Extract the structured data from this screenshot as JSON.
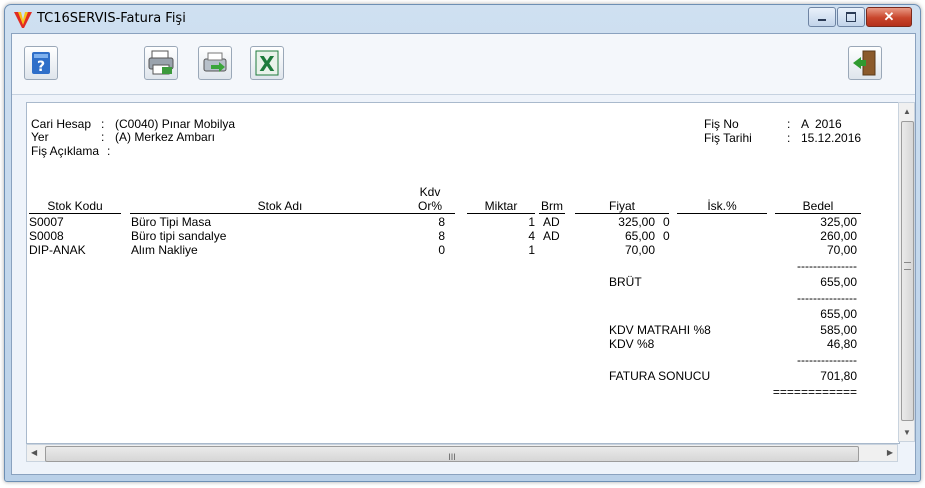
{
  "window": {
    "title": "TC16SERVIS-Fatura Fişi"
  },
  "toolbar": {
    "icons": [
      "help-icon",
      "print-preview-icon",
      "send-icon",
      "excel-icon",
      "exit-door-icon"
    ]
  },
  "header": {
    "cari_hesap_label": "Cari Hesap",
    "cari_hesap_value": "(C0040) Pınar Mobilya",
    "yer_label": "Yer",
    "yer_value": "(A) Merkez Ambarı",
    "fis_aciklama_label": "Fiş Açıklama",
    "fis_aciklama_value": "",
    "fis_no_label": "Fiş No",
    "fis_no_value": "A  2016",
    "fis_tarihi_label": "Fiş Tarihi",
    "fis_tarihi_value": "15.12.2016",
    "colon": ":"
  },
  "table": {
    "headers": {
      "stok_kodu": "Stok Kodu",
      "stok_adi": "Stok Adı",
      "kdv_line1": "Kdv",
      "kdv_line2": "Or%",
      "miktar": "Miktar",
      "brm": "Brm",
      "fiyat": "Fiyat",
      "isk": "İsk.%",
      "bedel": "Bedel"
    },
    "rows": [
      {
        "stok_kodu": "S0007",
        "stok_adi": "Büro Tipi Masa",
        "kdv": "8",
        "miktar": "1",
        "brm": "AD",
        "fiyat": "325,00",
        "isk": "0",
        "bedel": "325,00"
      },
      {
        "stok_kodu": "S0008",
        "stok_adi": "Büro tipi sandalye",
        "kdv": "8",
        "miktar": "4",
        "brm": "AD",
        "fiyat": "65,00",
        "isk": "0",
        "bedel": "260,00"
      },
      {
        "stok_kodu": "DIP-ANAK",
        "stok_adi": "Alım Nakliye",
        "kdv": "0",
        "miktar": "1",
        "brm": "",
        "fiyat": "70,00",
        "isk": "",
        "bedel": "70,00"
      }
    ]
  },
  "totals": {
    "dash_line": "---------------",
    "brut_label": "BRÜT",
    "brut_value": "655,00",
    "subtotal_value": "655,00",
    "kdv_matrahi_label": "KDV MATRAHI %8",
    "kdv_matrahi_value": "585,00",
    "kdv_label": "KDV %8",
    "kdv_value": "46,80",
    "fatura_sonucu_label": "FATURA SONUCU",
    "fatura_sonucu_value": "701,80",
    "equals_line": "============"
  },
  "scroll": {
    "hscroll_grip": "III"
  },
  "colors": {
    "excel_green": "#1e7b3c",
    "help_blue": "#2f6fc9",
    "close_red": "#c8452b"
  }
}
